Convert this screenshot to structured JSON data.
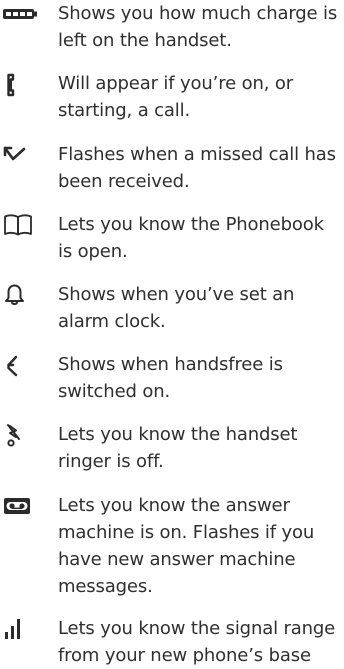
{
  "legend": {
    "items": [
      {
        "icon": "battery-icon",
        "text": "Shows you how much charge is\nleft on the handset."
      },
      {
        "icon": "phone-handset-icon",
        "text": "Will appear if you’re on, or\nstarting, a call."
      },
      {
        "icon": "missed-call-arrow-icon",
        "text": "Flashes when a missed call has\nbeen received."
      },
      {
        "icon": "phonebook-icon",
        "text": "Lets you know the Phonebook\nis open."
      },
      {
        "icon": "alarm-bell-icon",
        "text": "Shows when you’ve set an\nalarm clock."
      },
      {
        "icon": "handsfree-icon",
        "text": "Shows when handsfree is\nswitched on."
      },
      {
        "icon": "ringer-off-icon",
        "text": "Lets you know the handset\nringer is off."
      },
      {
        "icon": "answer-machine-icon",
        "text": "Lets you know the answer\nmachine is on. Flashes if you\nhave new answer machine\nmessages."
      },
      {
        "icon": "signal-strength-icon",
        "text": "Lets you know the signal range\nfrom your new phone’s base"
      }
    ]
  },
  "colors": {
    "text": "#2f2f2f",
    "icon": "#2b2b2b"
  }
}
